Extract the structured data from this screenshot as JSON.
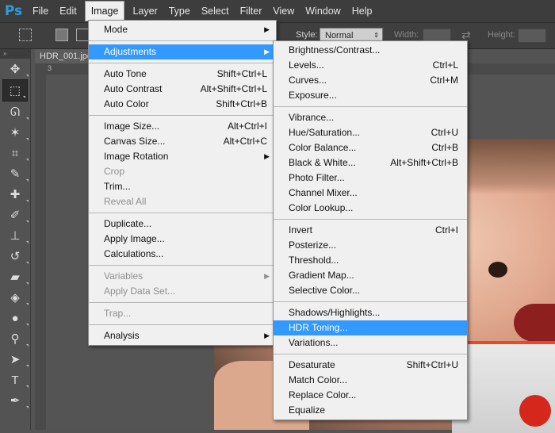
{
  "app": {
    "logo": "Ps"
  },
  "menubar": {
    "items": [
      "File",
      "Edit",
      "Image",
      "Layer",
      "Type",
      "Select",
      "Filter",
      "View",
      "Window",
      "Help"
    ]
  },
  "options": {
    "style_label": "Style:",
    "style_value": "Normal",
    "width_label": "Width:",
    "height_label": "Height:"
  },
  "document": {
    "tab": "HDR_001.jpg"
  },
  "ruler": {
    "h_marks": [
      "3"
    ]
  },
  "image_menu": {
    "items": [
      {
        "label": "Mode",
        "arrow": "▶"
      },
      {
        "sep": true
      },
      {
        "label": "Adjustments",
        "arrow": "▶",
        "highlight": true
      },
      {
        "sep": true
      },
      {
        "label": "Auto Tone",
        "shortcut": "Shift+Ctrl+L"
      },
      {
        "label": "Auto Contrast",
        "shortcut": "Alt+Shift+Ctrl+L"
      },
      {
        "label": "Auto Color",
        "shortcut": "Shift+Ctrl+B"
      },
      {
        "sep": true
      },
      {
        "label": "Image Size...",
        "shortcut": "Alt+Ctrl+I"
      },
      {
        "label": "Canvas Size...",
        "shortcut": "Alt+Ctrl+C"
      },
      {
        "label": "Image Rotation",
        "arrow": "▶"
      },
      {
        "label": "Crop",
        "disabled": true
      },
      {
        "label": "Trim..."
      },
      {
        "label": "Reveal All",
        "disabled": true
      },
      {
        "sep": true
      },
      {
        "label": "Duplicate..."
      },
      {
        "label": "Apply Image..."
      },
      {
        "label": "Calculations..."
      },
      {
        "sep": true
      },
      {
        "label": "Variables",
        "arrow": "▶",
        "disabled": true
      },
      {
        "label": "Apply Data Set...",
        "disabled": true
      },
      {
        "sep": true
      },
      {
        "label": "Trap...",
        "disabled": true
      },
      {
        "sep": true
      },
      {
        "label": "Analysis",
        "arrow": "▶"
      }
    ]
  },
  "adjustments_menu": {
    "items": [
      {
        "label": "Brightness/Contrast..."
      },
      {
        "label": "Levels...",
        "shortcut": "Ctrl+L"
      },
      {
        "label": "Curves...",
        "shortcut": "Ctrl+M"
      },
      {
        "label": "Exposure..."
      },
      {
        "sep": true
      },
      {
        "label": "Vibrance..."
      },
      {
        "label": "Hue/Saturation...",
        "shortcut": "Ctrl+U"
      },
      {
        "label": "Color Balance...",
        "shortcut": "Ctrl+B"
      },
      {
        "label": "Black & White...",
        "shortcut": "Alt+Shift+Ctrl+B"
      },
      {
        "label": "Photo Filter..."
      },
      {
        "label": "Channel Mixer..."
      },
      {
        "label": "Color Lookup..."
      },
      {
        "sep": true
      },
      {
        "label": "Invert",
        "shortcut": "Ctrl+I"
      },
      {
        "label": "Posterize..."
      },
      {
        "label": "Threshold..."
      },
      {
        "label": "Gradient Map..."
      },
      {
        "label": "Selective Color..."
      },
      {
        "sep": true
      },
      {
        "label": "Shadows/Highlights..."
      },
      {
        "label": "HDR Toning...",
        "highlight": true
      },
      {
        "label": "Variations..."
      },
      {
        "sep": true
      },
      {
        "label": "Desaturate",
        "shortcut": "Shift+Ctrl+U"
      },
      {
        "label": "Match Color..."
      },
      {
        "label": "Replace Color..."
      },
      {
        "label": "Equalize"
      }
    ]
  },
  "toolbar": {
    "tools": [
      {
        "icon": "move-tool-icon",
        "glyph": "✥"
      },
      {
        "icon": "marquee-tool-icon",
        "glyph": "⬚",
        "selected": true
      },
      {
        "icon": "lasso-tool-icon",
        "glyph": "ᘏ"
      },
      {
        "icon": "magic-wand-tool-icon",
        "glyph": "✶"
      },
      {
        "icon": "crop-tool-icon",
        "glyph": "⌗"
      },
      {
        "icon": "eyedropper-tool-icon",
        "glyph": "✎"
      },
      {
        "icon": "healing-brush-tool-icon",
        "glyph": "✚"
      },
      {
        "icon": "brush-tool-icon",
        "glyph": "✐"
      },
      {
        "icon": "clone-stamp-tool-icon",
        "glyph": "⊥"
      },
      {
        "icon": "history-brush-tool-icon",
        "glyph": "↺"
      },
      {
        "icon": "eraser-tool-icon",
        "glyph": "▰"
      },
      {
        "icon": "paint-bucket-tool-icon",
        "glyph": "◈"
      },
      {
        "icon": "blur-tool-icon",
        "glyph": "●"
      },
      {
        "icon": "dodge-tool-icon",
        "glyph": "⚲"
      },
      {
        "icon": "path-selection-tool-icon",
        "glyph": "➤"
      },
      {
        "icon": "type-tool-icon",
        "glyph": "T"
      },
      {
        "icon": "pen-tool-icon",
        "glyph": "✒"
      }
    ]
  }
}
